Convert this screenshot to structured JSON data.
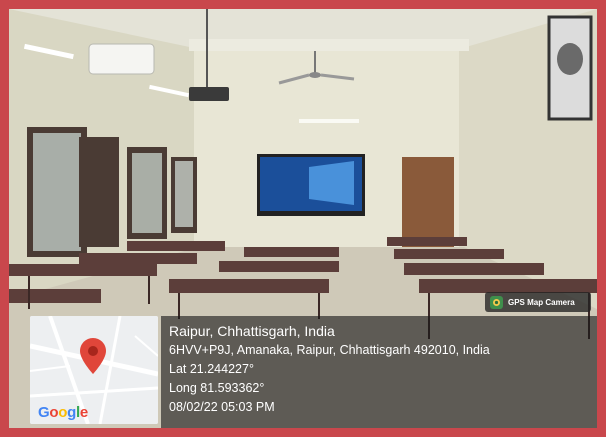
{
  "photo": {
    "subject": "empty classroom with desks, wall-mounted display, projector and ceiling fan"
  },
  "camera_badge": {
    "label": "GPS Map Camera",
    "icon": "gps-map-camera-icon"
  },
  "map": {
    "logo_letters": [
      "G",
      "o",
      "o",
      "g",
      "l",
      "e"
    ],
    "pin_icon": "map-pin-icon",
    "pin_color": "#e0463a"
  },
  "location": {
    "title": "Raipur, Chhattisgarh, India",
    "address": "6HVV+P9J, Amanaka, Raipur, Chhattisgarh 492010, India",
    "latitude": "Lat 21.244227°",
    "longitude": "Long 81.593362°",
    "datetime": "08/02/22 05:03 PM"
  },
  "colors": {
    "border": "#c9474c",
    "panel": "#191919"
  }
}
